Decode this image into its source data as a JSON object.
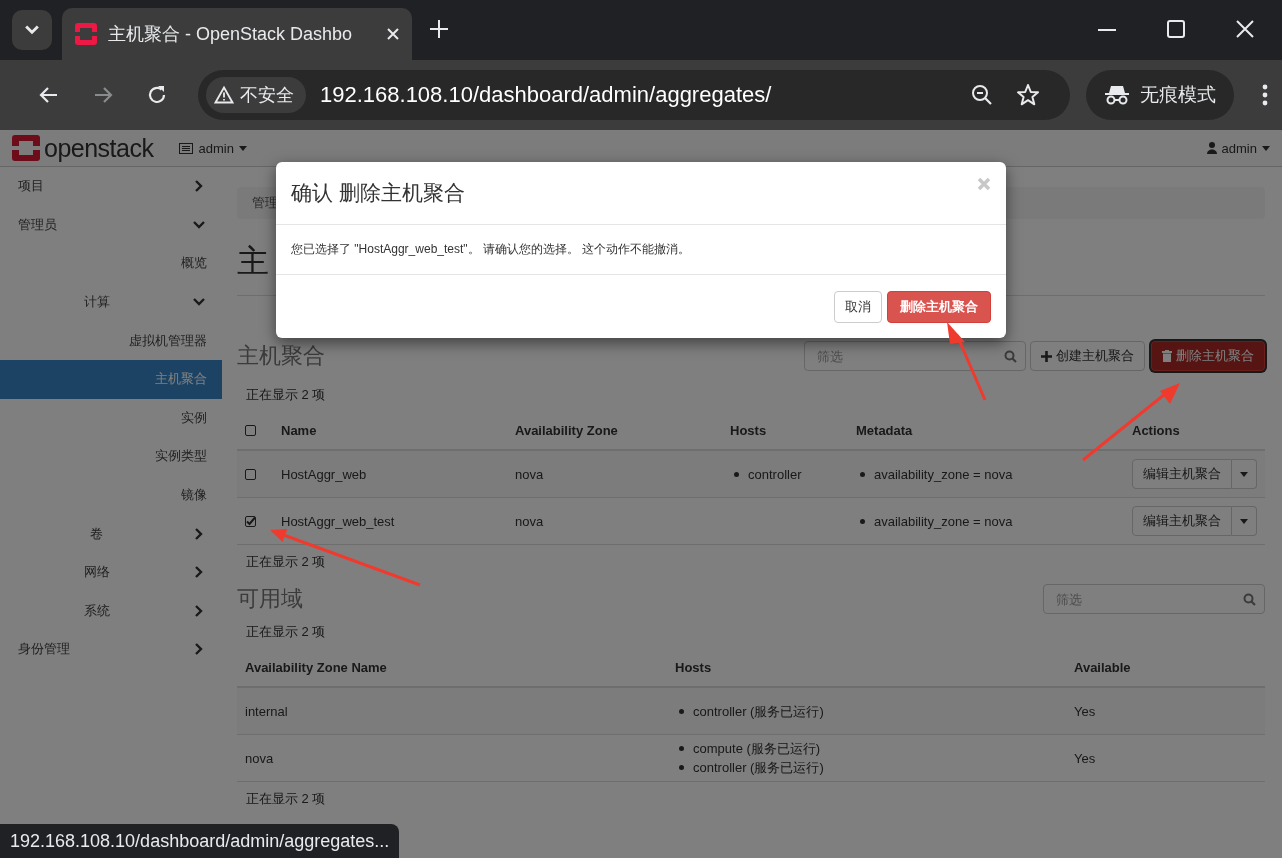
{
  "browser": {
    "tab_title": "主机聚合 - OpenStack Dashbo",
    "security": "不安全",
    "url": "192.168.108.10/dashboard/admin/aggregates/",
    "incognito": "无痕模式",
    "forward_disabled": true
  },
  "navbar": {
    "logo": "openstack",
    "project": "admin",
    "user": "admin"
  },
  "sidebar": {
    "items": [
      {
        "label": "项目",
        "expanded": false
      },
      {
        "label": "管理员",
        "expanded": true,
        "children": [
          {
            "label": "概览",
            "selected": false
          },
          {
            "label": "计算",
            "expanded": true,
            "children": [
              {
                "label": "虚拟机管理器",
                "selected": false
              },
              {
                "label": "主机聚合",
                "selected": true
              },
              {
                "label": "实例",
                "selected": false
              },
              {
                "label": "实例类型",
                "selected": false
              },
              {
                "label": "镜像",
                "selected": false
              }
            ]
          },
          {
            "label": "卷",
            "expanded": false
          },
          {
            "label": "网络",
            "expanded": false
          },
          {
            "label": "系统",
            "expanded": false
          }
        ]
      },
      {
        "label": "身份管理",
        "expanded": false
      }
    ]
  },
  "breadcrumb": "管理",
  "page_title": "主",
  "aggregates": {
    "heading": "主机聚合",
    "filter_placeholder": "筛选",
    "create_button": "创建主机聚合",
    "delete_button": {
      "label": "删除主机聚合",
      "focused": true
    },
    "count": "正在显示 2 项",
    "select_all_checked": false,
    "columns": [
      "Name",
      "Availability Zone",
      "Hosts",
      "Metadata",
      "Actions"
    ],
    "rows": [
      {
        "checked": false,
        "name": "HostAggr_web",
        "zone": "nova",
        "hosts": [
          "controller"
        ],
        "metadata": [
          "availability_zone = nova"
        ],
        "action": "编辑主机聚合"
      },
      {
        "checked": true,
        "name": "HostAggr_web_test",
        "zone": "nova",
        "hosts": [],
        "metadata": [
          "availability_zone = nova"
        ],
        "action": "编辑主机聚合"
      }
    ],
    "footer": "正在显示 2 项"
  },
  "zones": {
    "heading": "可用域",
    "filter_placeholder": "筛选",
    "count": "正在显示 2 项",
    "columns": [
      "Availability Zone Name",
      "Hosts",
      "Available"
    ],
    "rows": [
      {
        "name": "internal",
        "hosts": [
          "controller (服务已运行)"
        ],
        "available": "Yes"
      },
      {
        "name": "nova",
        "hosts": [
          "compute (服务已运行)",
          "controller (服务已运行)"
        ],
        "available": "Yes"
      }
    ],
    "footer": "正在显示 2 项"
  },
  "modal": {
    "title": "确认 删除主机聚合",
    "body": "您已选择了 \"HostAggr_web_test\"。 请确认您的选择。 这个动作不能撤消。",
    "cancel": "取消",
    "confirm": "删除主机聚合"
  },
  "status_url": "192.168.108.10/dashboard/admin/aggregates..."
}
